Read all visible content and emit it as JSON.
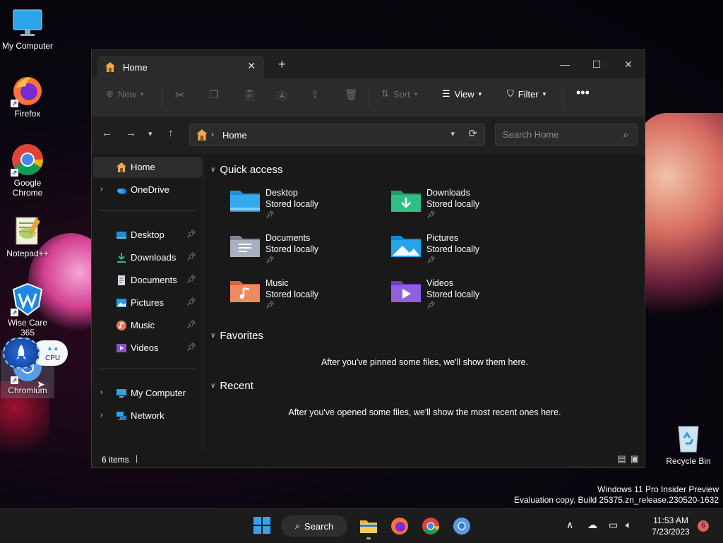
{
  "desktop": {
    "icons": [
      {
        "label": "My Computer"
      },
      {
        "label": "Firefox"
      },
      {
        "label": "Google Chrome"
      },
      {
        "label": "Notepad++"
      },
      {
        "label": "Wise Care 365"
      },
      {
        "label": "Chromium"
      }
    ],
    "cpu_widget_label": "CPU",
    "recycle_bin": "Recycle Bin"
  },
  "explorer": {
    "tab_title": "Home",
    "toolbar": {
      "new_label": "New",
      "sort_label": "Sort",
      "view_label": "View",
      "filter_label": "Filter"
    },
    "address": {
      "breadcrumb": "Home"
    },
    "search": {
      "placeholder": "Search Home"
    },
    "sidebar": {
      "items": [
        {
          "label": "Home"
        },
        {
          "label": "OneDrive"
        },
        {
          "label": "Desktop"
        },
        {
          "label": "Downloads"
        },
        {
          "label": "Documents"
        },
        {
          "label": "Pictures"
        },
        {
          "label": "Music"
        },
        {
          "label": "Videos"
        },
        {
          "label": "My Computer"
        },
        {
          "label": "Network"
        }
      ]
    },
    "sections": {
      "quick_access": "Quick access",
      "favorites": "Favorites",
      "recent": "Recent"
    },
    "quick_access": [
      {
        "name": "Desktop",
        "sub": "Stored locally"
      },
      {
        "name": "Downloads",
        "sub": "Stored locally"
      },
      {
        "name": "Documents",
        "sub": "Stored locally"
      },
      {
        "name": "Pictures",
        "sub": "Stored locally"
      },
      {
        "name": "Music",
        "sub": "Stored locally"
      },
      {
        "name": "Videos",
        "sub": "Stored locally"
      }
    ],
    "favorites_empty": "After you've pinned some files, we'll show them here.",
    "recent_empty": "After you've opened some files, we'll show the most recent ones here.",
    "status": {
      "items_count": "6 items"
    }
  },
  "watermark": {
    "line1": "Windows 11 Pro Insider Preview",
    "line2": "Evaluation copy. Build 25375.zn_release.230520-1632"
  },
  "taskbar": {
    "search_label": "Search",
    "time": "11:53 AM",
    "date": "7/23/2023",
    "notification_count": "6"
  },
  "colors": {
    "window_bg": "#191919",
    "toolbar_bg": "#2b2b2b",
    "accent": "#0078d4"
  }
}
